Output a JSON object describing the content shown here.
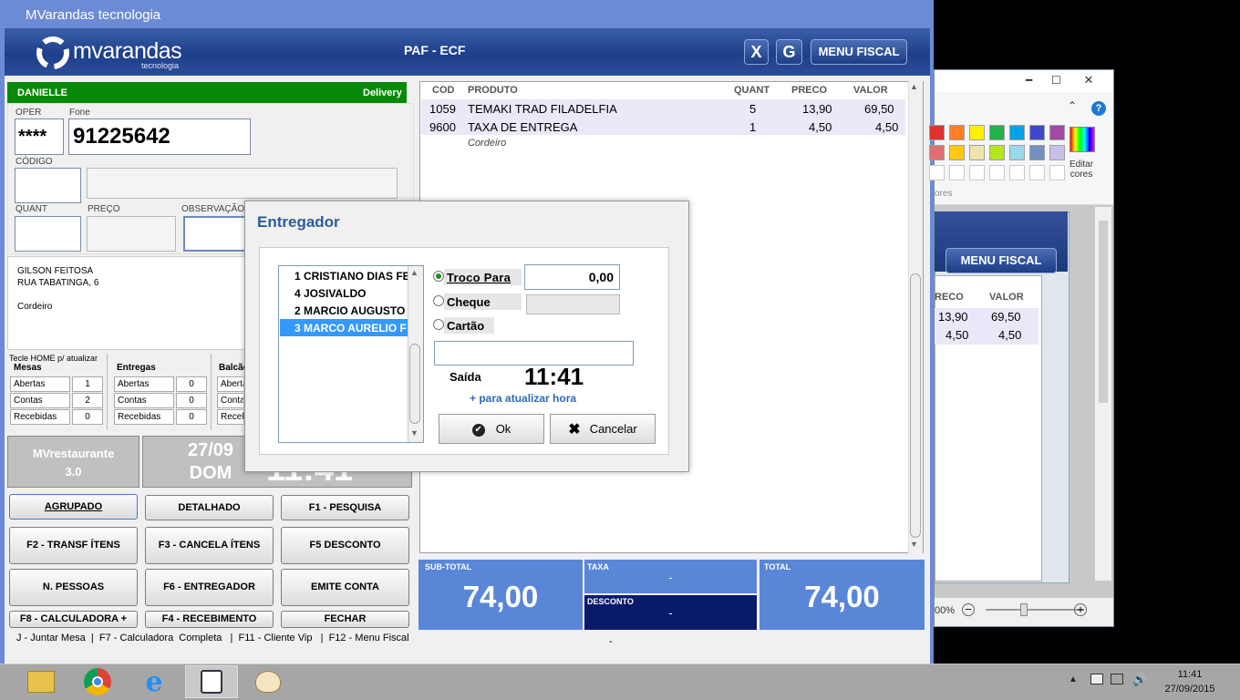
{
  "window": {
    "title": "MVarandas tecnologia"
  },
  "header": {
    "logo_text": "mvarandas",
    "logo_sub": "tecnologia",
    "title": "PAF - ECF",
    "btn_x": "X",
    "btn_g": "G",
    "btn_menu_fiscal": "MENU FISCAL"
  },
  "order": {
    "customer": "DANIELLE",
    "type": "Delivery",
    "oper_label": "OPER",
    "oper_value": "****",
    "fone_label": "Fone",
    "fone_value": "91225642",
    "codigo_label": "CÓDIGO",
    "quant_label": "QUANT",
    "preco_label": "PREÇO",
    "obs_label": "OBSERVAÇÃO"
  },
  "address": {
    "name": "GILSON FEITOSA",
    "street": "RUA TABATINGA, 6",
    "district": "Cordeiro"
  },
  "stats": {
    "hint": "Tecle HOME  p/ atualizar",
    "mesas": {
      "title": "Mesas",
      "rows": [
        {
          "label": "Abertas",
          "value": "1"
        },
        {
          "label": "Contas",
          "value": "2"
        },
        {
          "label": "Recebidas",
          "value": "0"
        }
      ]
    },
    "entregas": {
      "title": "Entregas",
      "rows": [
        {
          "label": "Abertas",
          "value": "0"
        },
        {
          "label": "Contas",
          "value": "0"
        },
        {
          "label": "Recebidas",
          "value": "0"
        }
      ]
    },
    "balcao": {
      "title": "Balcão",
      "rows": [
        {
          "label": "Abertas"
        },
        {
          "label": "Contas"
        },
        {
          "label": "Recebidas"
        }
      ]
    }
  },
  "info": {
    "product": "MVrestaurante",
    "version": "3.0",
    "date": "27/09",
    "weekday": "DOM",
    "clock": "11:41"
  },
  "buttons": [
    "AGRUPADO",
    "DETALHADO",
    "F1 - PESQUISA",
    "F2 - TRANSF ÍTENS",
    "F3 - CANCELA ÍTENS",
    "F5 DESCONTO",
    "N. PESSOAS",
    "F6 - ENTREGADOR",
    "EMITE CONTA",
    "F8 - CALCULADORA +",
    "F4 - RECEBIMENTO",
    "FECHAR"
  ],
  "footer": "J - Juntar Mesa  |  F7 - Calculadora  Completa   |  F11 - Cliente Vip   |  F12 - Menu Fiscal",
  "footer_mark": "-",
  "grid": {
    "headers": [
      "COD",
      "PRODUTO",
      "QUANT",
      "PRECO",
      "VALOR"
    ],
    "rows": [
      {
        "cod": "1059",
        "produto": "TEMAKI TRAD FILADELFIA",
        "quant": "5",
        "preco": "13,90",
        "valor": "69,50"
      },
      {
        "cod": "9600",
        "produto": "TAXA DE ENTREGA",
        "quant": "1",
        "preco": "4,50",
        "valor": "4,50"
      }
    ],
    "note": "Cordeiro"
  },
  "totals": {
    "subtotal_label": "SUB-TOTAL",
    "subtotal": "74,00",
    "taxa_label": "TAXA",
    "taxa": "-",
    "desconto_label": "DESCONTO",
    "desconto": "-",
    "total_label": "TOTAL",
    "total": "74,00"
  },
  "dialog": {
    "title": "Entregador",
    "list": [
      "1 CRISTIANO DIAS FE",
      "4 JOSIVALDO",
      "2 MARCIO AUGUSTO",
      "3 MARCO AURELIO F"
    ],
    "selected_index": 3,
    "troco_label": "Troco Para",
    "troco_value": "0,00",
    "cheque_label": "Cheque",
    "cartao_label": "Cartão",
    "saida_label": "Saída",
    "saida_time": "11:41",
    "refresh_hint": "+ para atualizar hora",
    "ok": "Ok",
    "cancel": "Cancelar"
  },
  "paint": {
    "edit_colors": "Editar cores",
    "colors_label": "ores",
    "menu_fiscal": "MENU FISCAL",
    "col_preco": "RECO",
    "col_valor": "VALOR",
    "rows": [
      {
        "preco": "13,90",
        "valor": "69,50"
      },
      {
        "preco": "4,50",
        "valor": "4,50"
      }
    ],
    "zoom": "00%",
    "palette_row1": [
      "#e03030",
      "#ff7f27",
      "#fff200",
      "#22b14c",
      "#00a2e8",
      "#3f48cc",
      "#a349a4"
    ],
    "palette_row2": [
      "#e07070",
      "#ffc90e",
      "#efe4b0",
      "#b5e61d",
      "#99d9ea",
      "#7092be",
      "#c8bfe7"
    ]
  },
  "tray": {
    "time": "11:41",
    "date": "27/09/2015"
  },
  "taskbar": {
    "icons": [
      "file-explorer-icon",
      "chrome-icon",
      "internet-explorer-icon",
      "mvarandas-app-icon",
      "paint-icon"
    ]
  }
}
